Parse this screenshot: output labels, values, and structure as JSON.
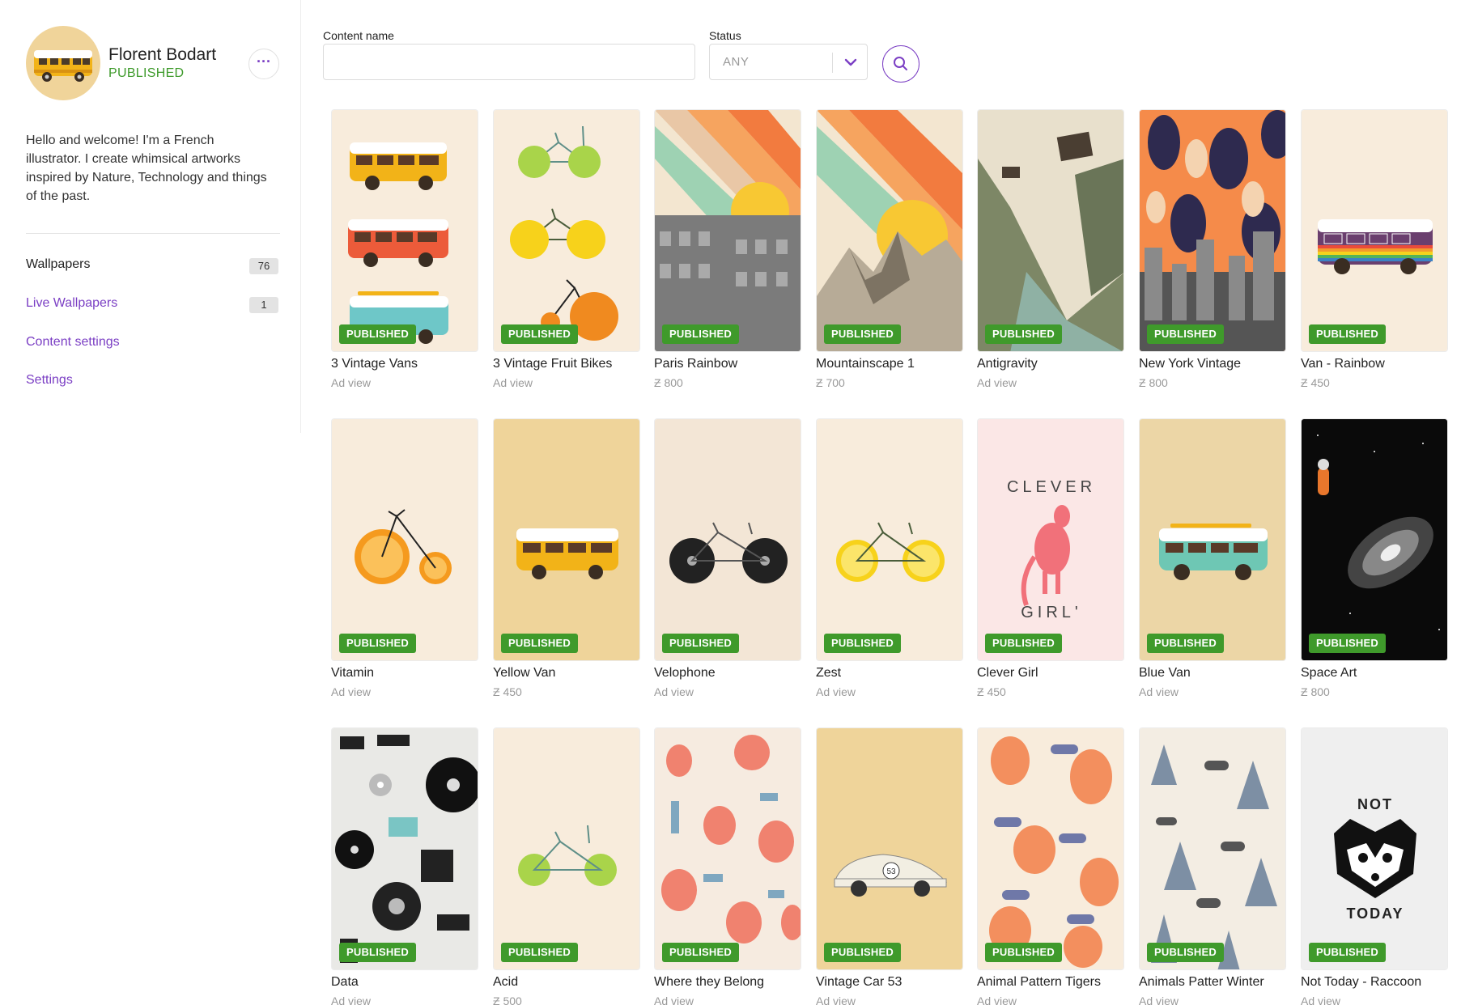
{
  "profile": {
    "name": "Florent Bodart",
    "status": "PUBLISHED",
    "more_label": "···",
    "bio": "Hello and welcome! I'm a French illustrator. I create whimsical artworks inspired by Nature, Technology and things of the past."
  },
  "nav": [
    {
      "label": "Wallpapers",
      "count": "76"
    },
    {
      "label": "Live Wallpapers",
      "count": "1"
    },
    {
      "label": "Content settings"
    },
    {
      "label": "Settings"
    }
  ],
  "filters": {
    "content_name_label": "Content name",
    "content_name_value": "",
    "status_label": "Status",
    "status_value": "ANY",
    "search_icon": "search-icon"
  },
  "colors": {
    "accent": "#7b3fc4",
    "published_green": "#3f9a2b"
  },
  "items": [
    {
      "title": "3 Vintage Vans",
      "sub": "Ad view",
      "badge": "PUBLISHED",
      "art": "vans3"
    },
    {
      "title": "3 Vintage Fruit Bikes",
      "sub": "Ad view",
      "badge": "PUBLISHED",
      "art": "bikes3"
    },
    {
      "title": "Paris Rainbow",
      "sub": "Ƶ 800",
      "badge": "PUBLISHED",
      "art": "paris"
    },
    {
      "title": "Mountainscape 1",
      "sub": "Ƶ 700",
      "badge": "PUBLISHED",
      "art": "mountain"
    },
    {
      "title": "Antigravity",
      "sub": "Ad view",
      "badge": "PUBLISHED",
      "art": "antigravity"
    },
    {
      "title": "New York Vintage",
      "sub": "Ƶ 800",
      "badge": "PUBLISHED",
      "art": "newyork"
    },
    {
      "title": "Van - Rainbow",
      "sub": "Ƶ 450",
      "badge": "PUBLISHED",
      "art": "vanrainbow"
    },
    {
      "title": "Vitamin",
      "sub": "Ad view",
      "badge": "PUBLISHED",
      "art": "vitamin"
    },
    {
      "title": "Yellow Van",
      "sub": "Ƶ 450",
      "badge": "PUBLISHED",
      "art": "yellowvan"
    },
    {
      "title": "Velophone",
      "sub": "Ad view",
      "badge": "PUBLISHED",
      "art": "velophone"
    },
    {
      "title": "Zest",
      "sub": "Ad view",
      "badge": "PUBLISHED",
      "art": "zest"
    },
    {
      "title": "Clever Girl",
      "sub": "Ƶ 450",
      "badge": "PUBLISHED",
      "art": "clevergirl",
      "art_text_top": "CLEVER",
      "art_text_bottom": "GIRL'"
    },
    {
      "title": "Blue Van",
      "sub": "Ad view",
      "badge": "PUBLISHED",
      "art": "bluevan"
    },
    {
      "title": "Space Art",
      "sub": "Ƶ 800",
      "badge": "PUBLISHED",
      "art": "space"
    },
    {
      "title": "Data",
      "sub": "Ad view",
      "badge": "PUBLISHED",
      "art": "data"
    },
    {
      "title": "Acid",
      "sub": "Ƶ 500",
      "badge": "PUBLISHED",
      "art": "acid"
    },
    {
      "title": "Where they Belong",
      "sub": "Ad view",
      "badge": "PUBLISHED",
      "art": "belong"
    },
    {
      "title": "Vintage Car 53",
      "sub": "Ad view",
      "badge": "PUBLISHED",
      "art": "car53",
      "art_text": "53"
    },
    {
      "title": "Animal Pattern Tigers",
      "sub": "Ad view",
      "badge": "PUBLISHED",
      "art": "tigers"
    },
    {
      "title": "Animals Patter Winter",
      "sub": "Ad view",
      "badge": "PUBLISHED",
      "art": "winter"
    },
    {
      "title": "Not Today - Raccoon",
      "sub": "Ad view",
      "badge": "PUBLISHED",
      "art": "raccoon",
      "art_text_top": "NOT",
      "art_text_bottom": "TODAY"
    }
  ]
}
